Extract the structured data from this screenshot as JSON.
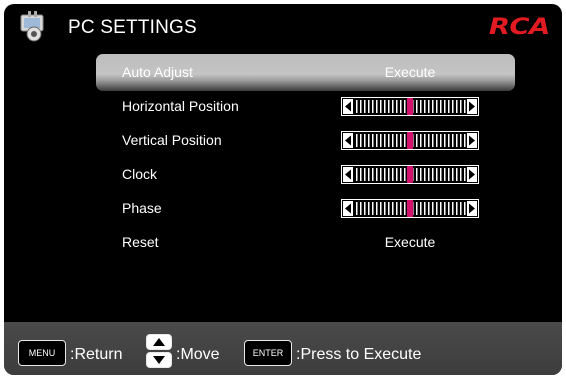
{
  "header": {
    "title": "PC SETTINGS",
    "brand": "RCA",
    "icon": "tv-settings-icon"
  },
  "menu": {
    "selected_index": 0,
    "items": [
      {
        "label": "Auto Adjust",
        "value": "Execute",
        "type": "action"
      },
      {
        "label": "Horizontal Position",
        "type": "slider",
        "level": 0.5
      },
      {
        "label": "Vertical Position",
        "type": "slider",
        "level": 0.5
      },
      {
        "label": "Clock",
        "type": "slider",
        "level": 0.5
      },
      {
        "label": "Phase",
        "type": "slider",
        "level": 0.5
      },
      {
        "label": "Reset",
        "value": "Execute",
        "type": "action"
      }
    ]
  },
  "footer": {
    "menu_key": "MENU",
    "menu_action": ":Return",
    "move_action": ":Move",
    "enter_key": "ENTER",
    "enter_action": ":Press to Execute"
  },
  "colors": {
    "brand": "#e21b22",
    "slider_marker": "#d4126e",
    "highlight": "#c0c0c0",
    "background": "#000000"
  }
}
